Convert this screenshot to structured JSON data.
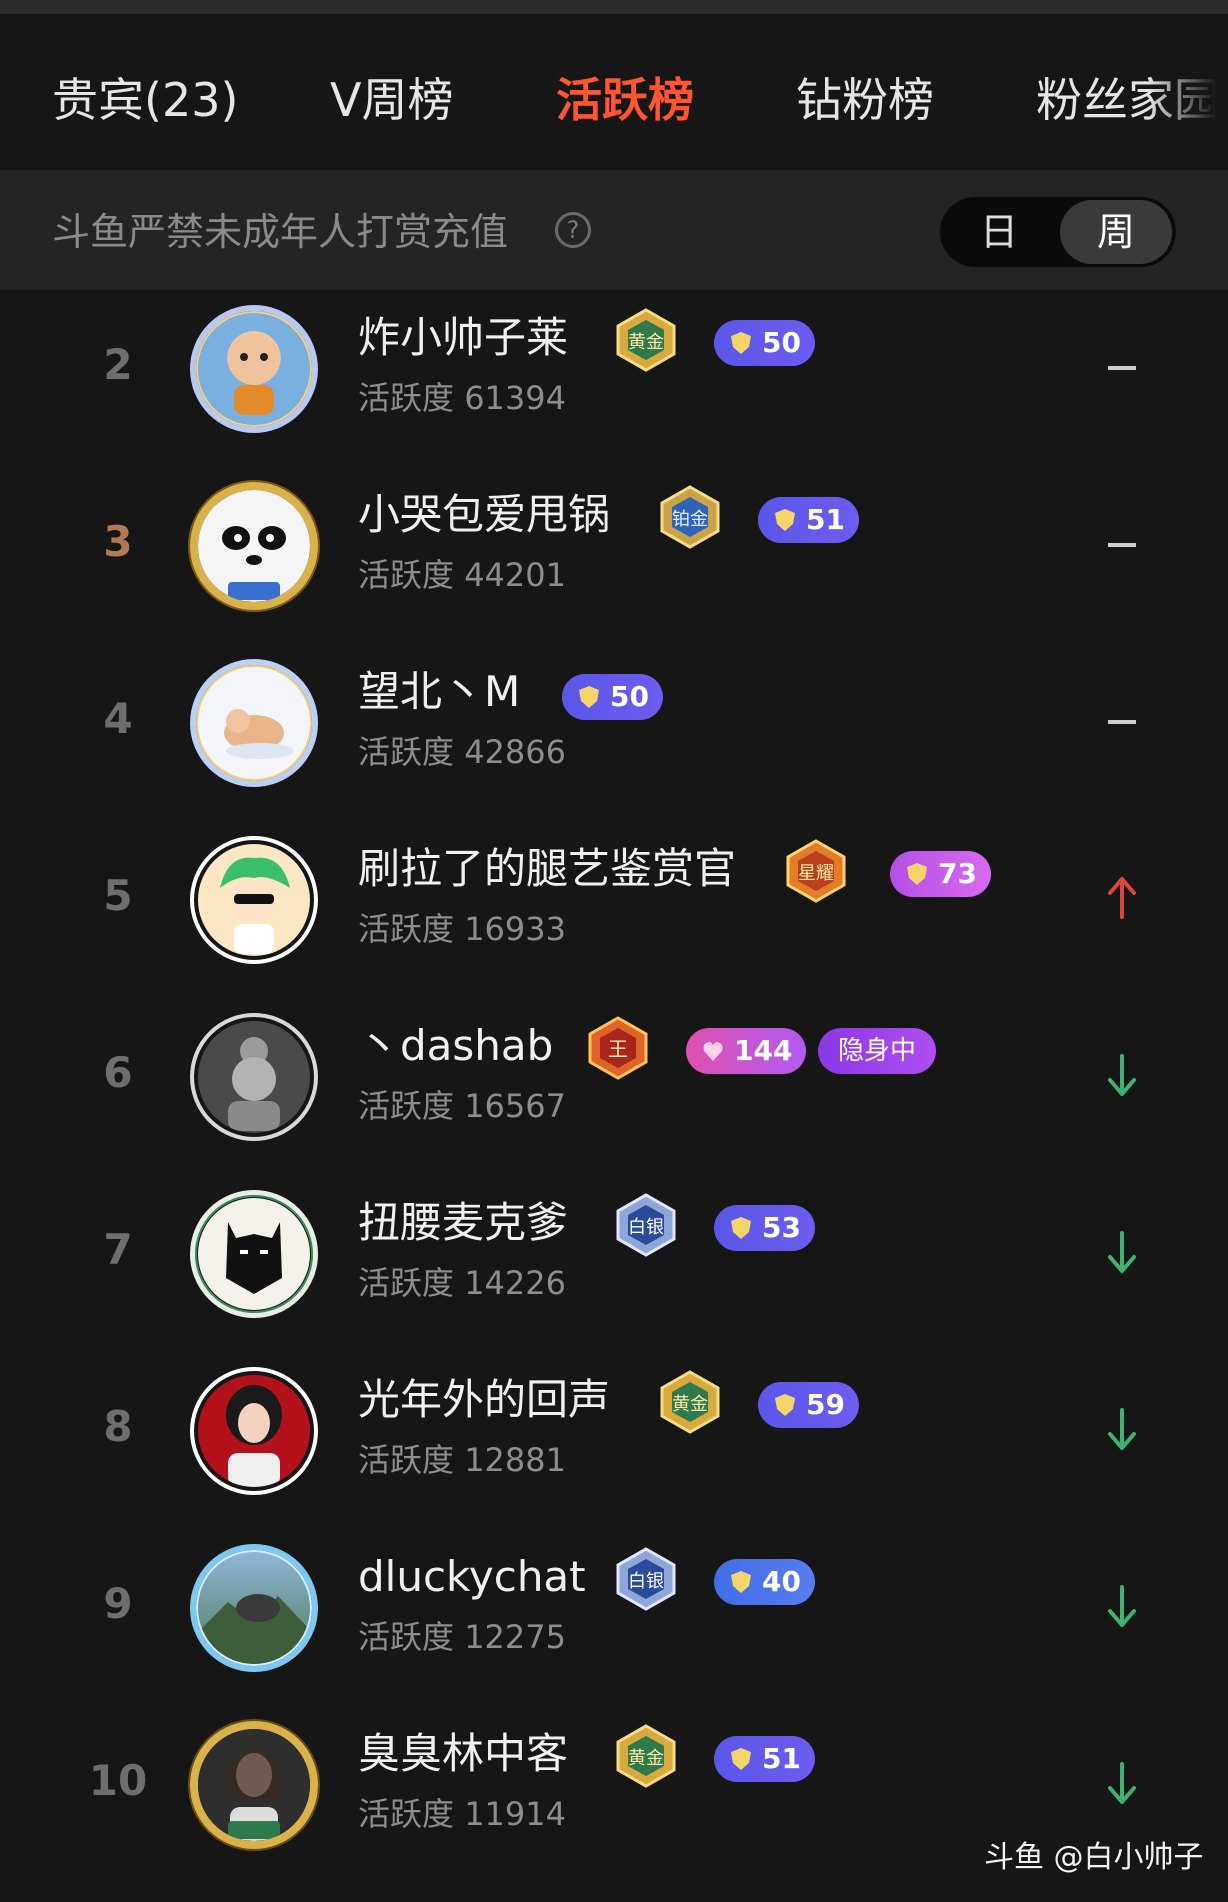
{
  "tabs": [
    {
      "label": "贵宾(23)",
      "active": false
    },
    {
      "label": "V周榜",
      "active": false
    },
    {
      "label": "活跃榜",
      "active": true
    },
    {
      "label": "钻粉榜",
      "active": false
    },
    {
      "label": "粉丝家园",
      "active": false
    }
  ],
  "notice": {
    "text": "斗鱼严禁未成年人打赏充值",
    "help_icon": "question-circle-icon"
  },
  "period_toggle": {
    "day_label": "日",
    "week_label": "周",
    "selected": "周"
  },
  "score_label": "活跃度",
  "entries": [
    {
      "rank": "2",
      "name": "炸小帅子莱",
      "score": "61394",
      "tier": "黄金",
      "level": "50",
      "trend": "same",
      "avatar": "cartoon-avatar"
    },
    {
      "rank": "3",
      "name": "小哭包爱甩锅",
      "score": "44201",
      "tier": "铂金",
      "level": "51",
      "trend": "same",
      "avatar": "panda-avatar"
    },
    {
      "rank": "4",
      "name": "望北丶M",
      "score": "42866",
      "tier": "",
      "level": "50",
      "trend": "same",
      "avatar": "cat-avatar"
    },
    {
      "rank": "5",
      "name": "刷拉了的腿艺鉴赏官",
      "score": "16933",
      "tier": "星耀",
      "level": "73",
      "trend": "up",
      "avatar": "green-hair-avatar"
    },
    {
      "rank": "6",
      "name": "丶dashab",
      "score": "16567",
      "tier": "王",
      "level": "144",
      "hidden_label": "隐身中",
      "trend": "down",
      "avatar": "gray-avatar"
    },
    {
      "rank": "7",
      "name": "扭腰麦克爹",
      "score": "14226",
      "tier": "白银",
      "level": "53",
      "trend": "down",
      "avatar": "batman-avatar"
    },
    {
      "rank": "8",
      "name": "光年外的回声",
      "score": "12881",
      "tier": "黄金",
      "level": "59",
      "trend": "down",
      "avatar": "portrait-avatar"
    },
    {
      "rank": "9",
      "name": "dluckychat",
      "score": "12275",
      "tier": "白银",
      "level": "40",
      "trend": "down",
      "avatar": "landscape-avatar"
    },
    {
      "rank": "10",
      "name": "臭臭林中客",
      "score": "11914",
      "tier": "黄金",
      "level": "51",
      "trend": "down",
      "avatar": "photo-avatar"
    }
  ],
  "colors": {
    "active_tab": "#ff5530",
    "trend_up": "#e0453a",
    "trend_down": "#3cb371",
    "level_badge": "#5a57e8"
  },
  "watermark": "斗鱼 @白小帅子"
}
